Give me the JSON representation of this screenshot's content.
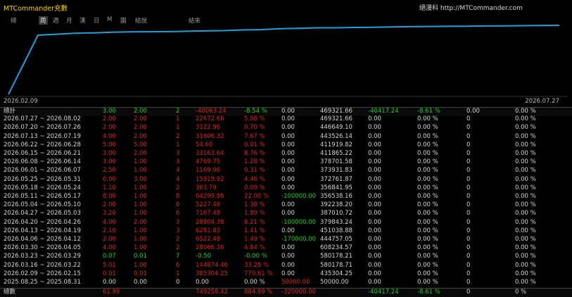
{
  "app": {
    "title": "MTCommander充數",
    "site": "絕漫科 http://MTCommander.com"
  },
  "tabs": [
    {
      "label": "總",
      "active": false
    },
    {
      "label": "周",
      "active": true
    },
    {
      "label": "週",
      "active": false
    },
    {
      "label": "月",
      "active": false
    },
    {
      "label": "漢",
      "active": false
    },
    {
      "label": "日",
      "active": false
    },
    {
      "label": "M",
      "active": false
    },
    {
      "label": "園",
      "active": false
    },
    {
      "label": "結說",
      "active": false
    },
    {
      "label": "結來",
      "active": false
    }
  ],
  "chart": {
    "start_label": "2026.02.09",
    "end_label": "2026.07.27",
    "line_color": "#1ea0e0",
    "series": [
      0,
      360000,
      366000,
      372000,
      374000,
      378000,
      380000,
      381000,
      382000,
      384000,
      386000,
      388000,
      392000,
      394000,
      400000,
      402000,
      405000,
      405000,
      407000,
      408000,
      410000,
      412000,
      413000,
      414000,
      415000,
      416000,
      416500,
      418000,
      419000,
      420000
    ]
  },
  "colors": {
    "red": "#e02020",
    "green": "#20d020",
    "white": "#d6d6d6",
    "accent": "#ffd200"
  },
  "summary": [
    "總計",
    "3.00",
    "2.00",
    "2",
    "-40063.24",
    "-8.54 %",
    "0.00",
    "469321.66",
    "-40417.24",
    "-8.61 %",
    "0.00",
    "0",
    "0.00 %"
  ],
  "rows": [
    {
      "c": "r",
      "v": [
        "2026.07.27 ~ 2026.08.02",
        "2.00",
        "2.00",
        "1",
        "22672.66",
        "5.08 %",
        "0.00",
        "469321.66",
        "0.00",
        "0.00 %",
        "0",
        "0.00 %"
      ]
    },
    {
      "c": "r",
      "v": [
        "2026.07.20 ~ 2026.07.26",
        "2.00",
        "2.00",
        "1",
        "3122.96",
        "0.70 %",
        "0.00",
        "446649.10",
        "0.00",
        "0.00 %",
        "0",
        "0.00 %"
      ]
    },
    {
      "c": "r",
      "v": [
        "2026.07.13 ~ 2026.07.19",
        "4.00",
        "2.00",
        "2",
        "31606.32",
        "7.67 %",
        "0.00",
        "443526.14",
        "0.00",
        "0.00 %",
        "0",
        "0.00 %"
      ]
    },
    {
      "c": "r",
      "v": [
        "2026.06.22 ~ 2026.06.28",
        "5.00",
        "5.00",
        "1",
        "54.60",
        "0.01 %",
        "0.00",
        "411919.82",
        "0.00",
        "0.00 %",
        "0",
        "0.00 %"
      ]
    },
    {
      "c": "r",
      "v": [
        "2026.06.15 ~ 2026.06.21",
        "3.00",
        "2.00",
        "3",
        "33163.64",
        "8.76 %",
        "0.00",
        "411865.22",
        "0.00",
        "0.00 %",
        "0",
        "0.00 %"
      ]
    },
    {
      "c": "r",
      "v": [
        "2026.06.08 ~ 2026.06.14",
        "3.00",
        "1.00",
        "3",
        "4769.75",
        "1.28 %",
        "0.00",
        "378701.58",
        "0.00",
        "0.00 %",
        "0",
        "0.00 %"
      ]
    },
    {
      "c": "r",
      "v": [
        "2026.06.01 ~ 2026.06.07",
        "2.50",
        "1.00",
        "4",
        "1169.96",
        "0.31 %",
        "0.00",
        "373931.83",
        "0.00",
        "0.00 %",
        "0",
        "0.00 %"
      ]
    },
    {
      "c": "r",
      "v": [
        "2026.05.25 ~ 2026.05.31",
        "6.00",
        "3.00",
        "4",
        "15919.92",
        "4.46 %",
        "0.00",
        "372761.87",
        "0.00",
        "0.00 %",
        "0",
        "0.00 %"
      ]
    },
    {
      "c": "r",
      "v": [
        "2026.05.18 ~ 2026.05.24",
        "1.10",
        "1.00",
        "2",
        "303.79",
        "0.09 %",
        "0.00",
        "356841.95",
        "0.00",
        "0.00 %",
        "0",
        "0.00 %"
      ]
    },
    {
      "c": "rg",
      "v": [
        "2026.05.11 ~ 2026.05.17",
        "8.00",
        "1.00",
        "8",
        "64299.96",
        "22.00 %",
        "-100000.00",
        "356538.16",
        "0.00",
        "0.00 %",
        "0",
        "0.00 %"
      ]
    },
    {
      "c": "r",
      "v": [
        "2026.05.04 ~ 2026.05.10",
        "2.00",
        "1.00",
        "6",
        "5227.48",
        "1.38 %",
        "0.00",
        "392238.20",
        "0.00",
        "0.00 %",
        "0",
        "0.00 %"
      ]
    },
    {
      "c": "r",
      "v": [
        "2026.04.27 ~ 2026.05.03",
        "3.20",
        "1.00",
        "6",
        "7167.48",
        "1.89 %",
        "0.00",
        "387010.72",
        "0.00",
        "0.00 %",
        "0",
        "0.00 %"
      ]
    },
    {
      "c": "rg",
      "v": [
        "2026.04.20 ~ 2026.04.26",
        "4.00",
        "2.00",
        "3",
        "28804.38",
        "8.21 %",
        "-100000.00",
        "379843.24",
        "0.00",
        "0.00 %",
        "0",
        "0.00 %"
      ]
    },
    {
      "c": "r",
      "v": [
        "2026.04.13 ~ 2026.04.19",
        "2.10",
        "1.00",
        "3",
        "6281.83",
        "1.41 %",
        "0.00",
        "451038.88",
        "0.00",
        "0.00 %",
        "0",
        "0.00 %"
      ]
    },
    {
      "c": "rg",
      "v": [
        "2026.04.06 ~ 2026.04.12",
        "2.00",
        "1.00",
        "2",
        "6522.48",
        "1.49 %",
        "-170000.00",
        "444757.05",
        "0.00",
        "0.00 %",
        "0",
        "0.00 %"
      ]
    },
    {
      "c": "r",
      "v": [
        "2026.03.30 ~ 2026.04.05",
        "4.00",
        "1.00",
        "2",
        "28066.36",
        "4.84 %",
        "0.00",
        "608234.57",
        "0.00",
        "0.00 %",
        "0",
        "0.00 %"
      ]
    },
    {
      "c": "g",
      "v": [
        "2026.03.23 ~ 2026.03.29",
        "0.07",
        "0.01",
        "7",
        "-0.50",
        "-0.00 %",
        "0.00",
        "580178.21",
        "0.00",
        "0.00 %",
        "0",
        "0.00 %"
      ]
    },
    {
      "c": "r",
      "v": [
        "2026.03.16 ~ 2026.03.22",
        "5.01",
        "1.00",
        "6",
        "144874.46",
        "33.28 %",
        "0.00",
        "580178.71",
        "0.00",
        "0.00 %",
        "0",
        "0.00 %"
      ]
    },
    {
      "c": "r",
      "v": [
        "2026.02.09 ~ 2026.02.15",
        "0.01",
        "0.01",
        "1",
        "385304.25",
        "770.61 %",
        "0.00",
        "435304.25",
        "0.00",
        "0.00 %",
        "0",
        "0.00 %"
      ]
    },
    {
      "c": "w",
      "v": [
        "2025.08.25 ~ 2025.08.31",
        "0.00",
        "0.00",
        "0",
        "0.00",
        "0.00 %",
        "50000.00",
        "50000.00",
        "0.00",
        "0.00 %",
        "0",
        "0.00 %"
      ]
    }
  ],
  "total": [
    "總數",
    "61.99",
    "",
    "",
    "749258.42",
    "884.89 %",
    "-320000.00",
    "",
    "-40417.24",
    "-8.61 %",
    "0",
    "0 %"
  ]
}
